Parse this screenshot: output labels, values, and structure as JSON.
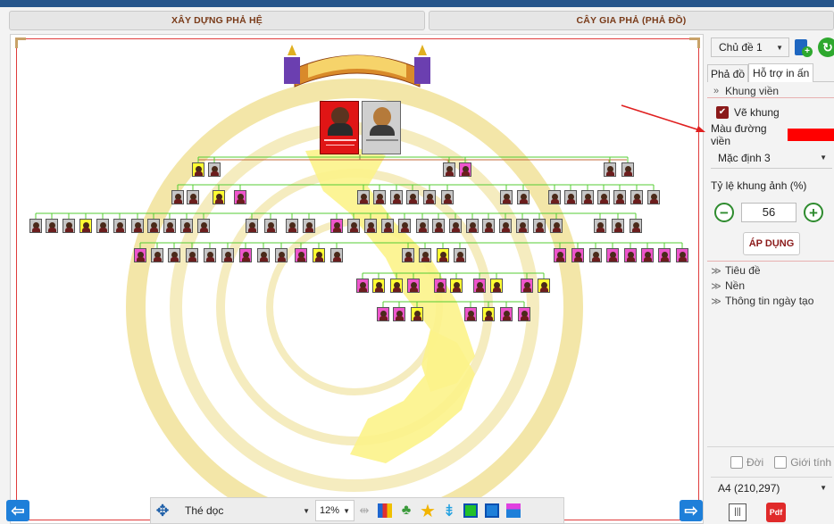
{
  "tabs": {
    "build": "XÂY DỰNG PHẢ HỆ",
    "tree": "CÂY GIA PHẢ (PHẢ ĐỒ)"
  },
  "sidebar": {
    "theme": "Chủ đề 1",
    "subtabs": {
      "map": "Phả đồ",
      "print": "Hỗ trợ in ấn"
    },
    "frame_section": "Khung viền",
    "draw_frame": "Vẽ khung",
    "border_color_label": "Màu đường viền",
    "border_color": "#ff0000",
    "default_style": "Mặc định 3",
    "ratio_label": "Tỷ lệ khung ảnh (%)",
    "ratio_value": "56",
    "apply": "ÁP DỤNG",
    "title_section": "Tiêu đề",
    "bg_section": "Nền",
    "created_section": "Thông tin ngày tạo",
    "generation": "Đời",
    "gender": "Giới tính",
    "paper": "A4 (210,297)",
    "pdf": "Pdf"
  },
  "toolbar": {
    "orientation": "Thé dọc",
    "zoom": "12%"
  },
  "colors": {
    "female": "#ee55cc",
    "male": "#c6c6c6",
    "highlight": "#ffff33",
    "edge": "#55cc33",
    "accent": "#1e7fd9"
  }
}
